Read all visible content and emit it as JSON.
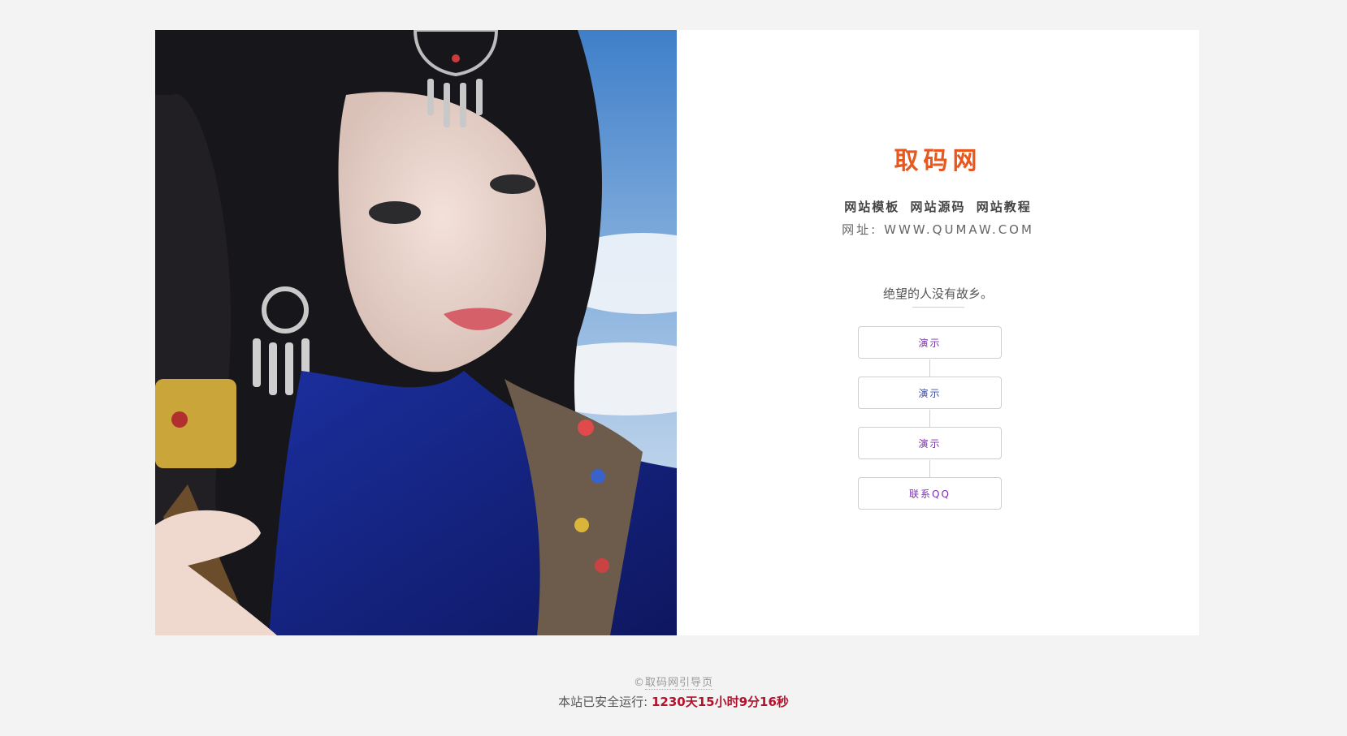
{
  "brand": "取码网",
  "tags": [
    "网站模板",
    "网站源码",
    "网站教程"
  ],
  "url": {
    "label": "网址:",
    "value": "WWW.QUMAW.COM"
  },
  "quote": "绝望的人没有故乡。",
  "buttons": [
    "演示",
    "演示",
    "演示",
    "联系QQ"
  ],
  "footer": {
    "copyright_symbol": "©",
    "copyright_link": "取码网引导页",
    "run_label": "本站已安全运行:",
    "run_time": "1230天15小时9分16秒"
  },
  "colors": {
    "brand": "#e8571e",
    "button_text": "#7a2fb0",
    "timer": "#b3122b",
    "background": "#f3f3f3"
  }
}
